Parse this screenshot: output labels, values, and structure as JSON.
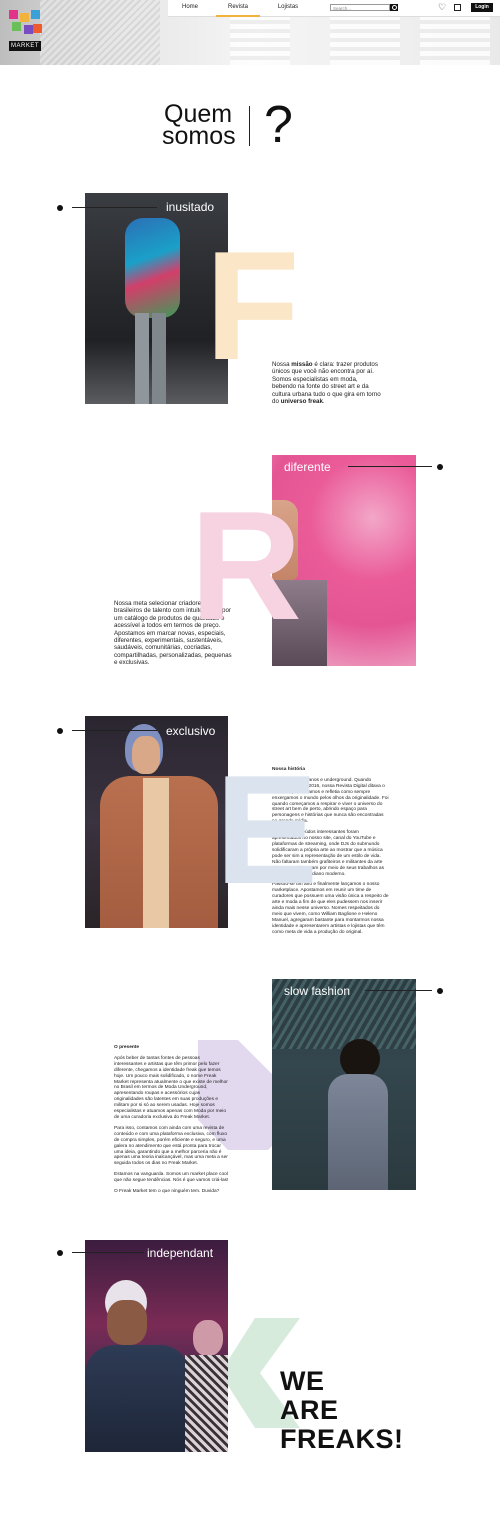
{
  "header": {
    "logo_text": "MARKET",
    "nav": [
      {
        "label": "Home"
      },
      {
        "label": "Revista",
        "active": true
      },
      {
        "label": "Lojistas"
      }
    ],
    "search_placeholder": "Search...",
    "login_label": "Login",
    "accent": "#f2b33d"
  },
  "title": {
    "line1": "Quem",
    "line2": "somos",
    "mark": "?"
  },
  "sections": [
    {
      "tag": "inusitado",
      "letter": "F",
      "letter_color": "#fbe7c8",
      "text_html": "Nossa <b>missão</b> é clara: trazer produtos únicos que você não encontra por aí. Somos especialistas em moda, bebendo na fonte do street art e da cultura urbana tudo o que gira em torno do <b>universo freak</b>."
    },
    {
      "tag": "diferente",
      "letter": "R",
      "letter_color": "#f7d2e1",
      "text": "Nossa meta selecionar criadores brasileiros de talento com intuito de propor um catálogo de produtos de qualidade e acessível a todos em termos de preço. Apostamos em marcar novas, especiais, diferentes, experimentais, sustentáveis, saudáveis, comunitárias, cocriadas, compartilhadas, personalizadas, pequenas e exclusivas."
    },
    {
      "tag": "exclusivo",
      "letter": "E",
      "letter_color": "#dbe3ee",
      "heading": "Nossa história",
      "paragraphs": [
        "Já nascemos urbanos e underground. Quando começamos, em 2016, nossa Revista Digital ditava o ritmo de quem éramos e refletia como sempre enxergamos o mundo pelos olhos da originalidade. Foi quando começamos a respirar e viver o universo do street art bem de perto, abrindo espaço para personagens e histórias que nunca são encontradas na grande mídia.",
        "Inúmeros conteúdos interessantes foram apresentados no nosso site, canal do YouTube e plataformas de streaming, onde DJs do submundo solidificaram a própria arte ao mostrar que a música pode ser sim a representação de um estilo de vida. Não faltaram também grafiteiros e militantes da arte urbana, que berraram por meio de seus trabalhos as intempéries do cotidiano moderno.",
        "Passou-se um ano e finalmente lançamos o nosso marketplace. Apostamos em reunir um time de curadores que possuem uma visão única a respeito de arte e moda a fim de que eles pudessem nos inserir ainda mais nesse universo. Nomes respeitados do meio que vivem, como William Baglione e Heleno Manuel, agregaram bastante para montarmos nossa identidade e apresentarem artistas e lojistas que têm como meta de vida a produção do original."
      ]
    },
    {
      "tag": "slow fashion",
      "letter": "A",
      "letter_color": "#e2d9ef",
      "heading": "O presente",
      "paragraphs": [
        "Após beber de tantas fontes de pessoas interessantes e artistas que têm primor pelo fazer diferente, chegamos a identidade freak que temos hoje. Um pouco mais solidificado, o nome Freak Market representa atualmente o que existe de melhor no Brasil em termos de Moda Underground, apresentando roupas e acessórios cujas originalidades são latentes em suas produções e militam por si só ao serem usadas. Hoje somos especialistas e atuamos apenas com Moda por meio de uma curadoria exclusiva do Freak Market.",
        "Para isso, contamos com ainda com uma revista de conteúdo e com uma plataforma exclusiva, com fluxo de compra simples, porém eficiente e seguro, e uma galera no atendimento que está pronta para trocar uma ideia, garantindo que a melhor parceria não é apenas uma teoria inalcançável, mas uma meta a ser seguida todos os dias no Freak Market.",
        "Estamos na vanguarda. Somos um market place cool que não segue tendências. Nós é que vamos criá-las!",
        "O Freak Market tem o que ninguém tem. Duvida?"
      ]
    },
    {
      "tag": "independant",
      "letter": "K",
      "letter_color": "#d7ebdc"
    }
  ],
  "closing": {
    "line1": "WE",
    "line2": "ARE",
    "line3": "FREAKS!"
  }
}
